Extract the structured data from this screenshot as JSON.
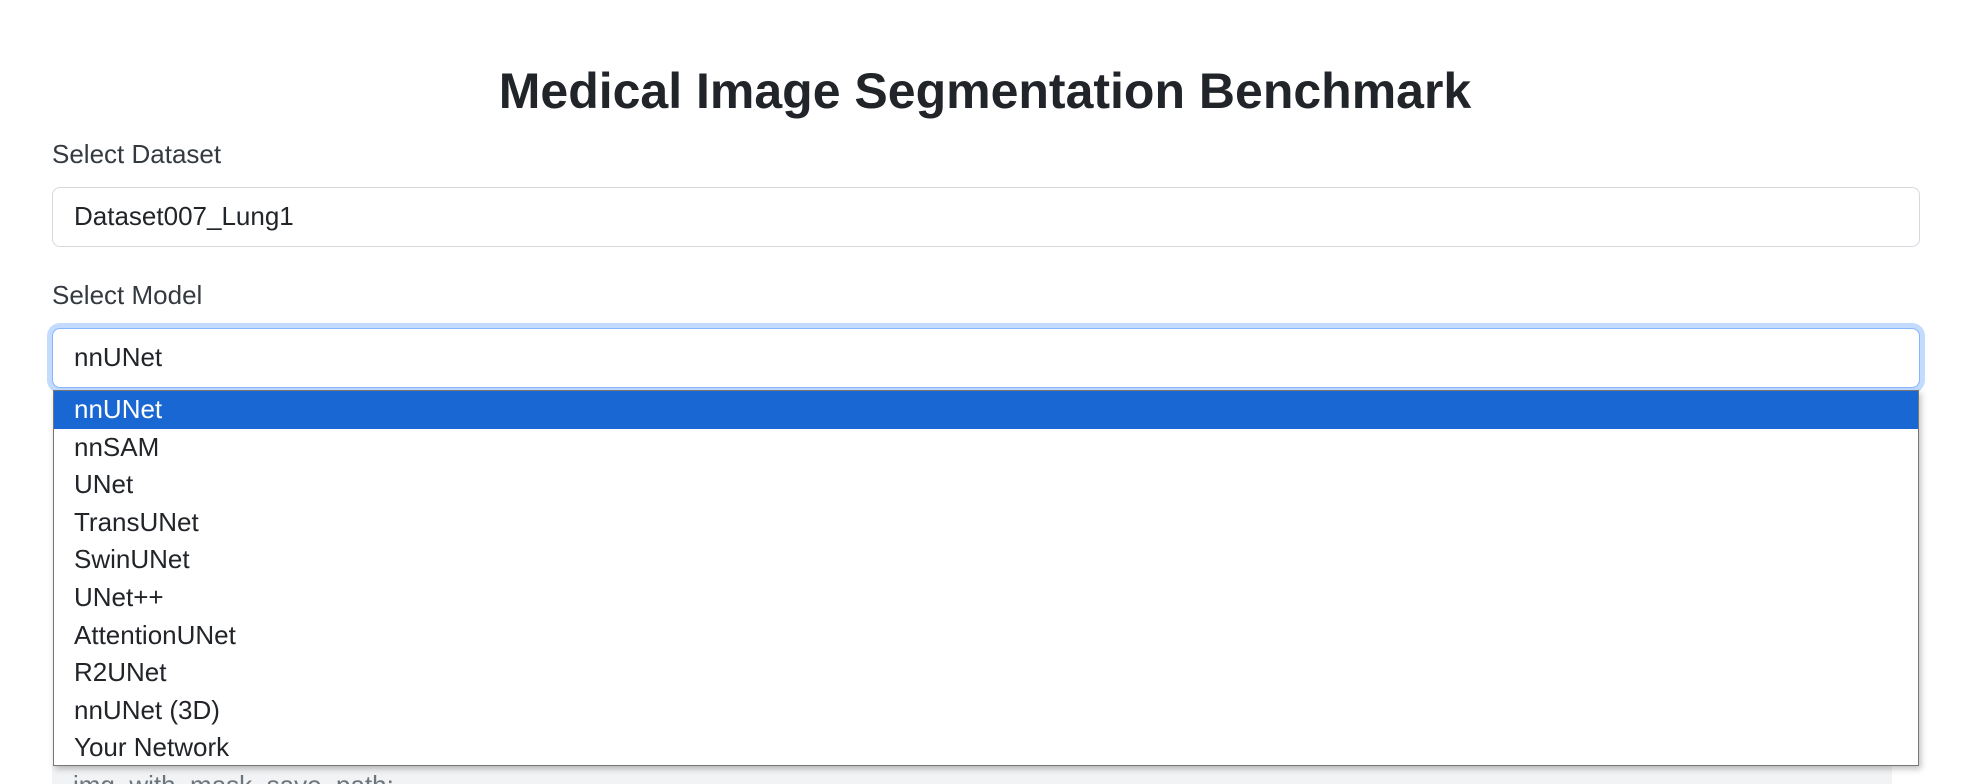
{
  "page": {
    "title": "Medical Image Segmentation Benchmark"
  },
  "dataset": {
    "label": "Select Dataset",
    "value": "Dataset007_Lung1"
  },
  "model": {
    "label": "Select Model",
    "value": "nnUNet",
    "options": [
      "nnUNet",
      "nnSAM",
      "UNet",
      "TransUNet",
      "SwinUNet",
      "UNet++",
      "AttentionUNet",
      "R2UNet",
      "nnUNet (3D)",
      "Your Network"
    ],
    "highlighted_index": 0
  },
  "obscured_field": {
    "placeholder": "img_with_mask_save_path:"
  },
  "colors": {
    "highlight": "#1967d2",
    "focus_ring": "#86b7fe",
    "text": "#212529"
  }
}
